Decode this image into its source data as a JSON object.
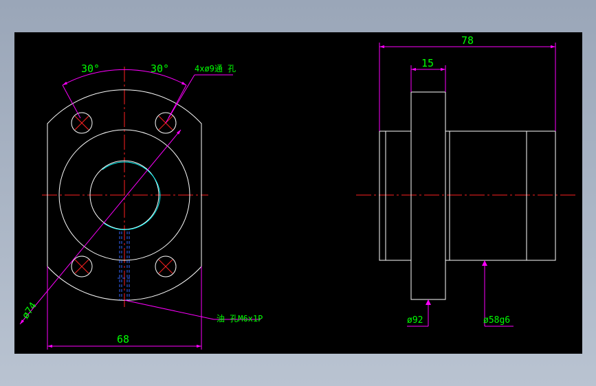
{
  "colors": {
    "background": "#000000",
    "outline": "#ffffff",
    "centerline": "#ff2020",
    "dimension": "#ff00ff",
    "text": "#00ff00",
    "hidden": "#3366ff",
    "thread": "#00ffff"
  },
  "front_view": {
    "angle_left": "30°",
    "angle_right": "30°",
    "hole_callout": "4xø9通 孔",
    "diameter_pcd": "ø74",
    "width_dim": "68",
    "oil_hole_callout": "油 孔M6x1P"
  },
  "side_view": {
    "length_dim": "78",
    "flange_thickness": "15",
    "flange_diameter": "ø92",
    "body_diameter": "ø58g6"
  }
}
